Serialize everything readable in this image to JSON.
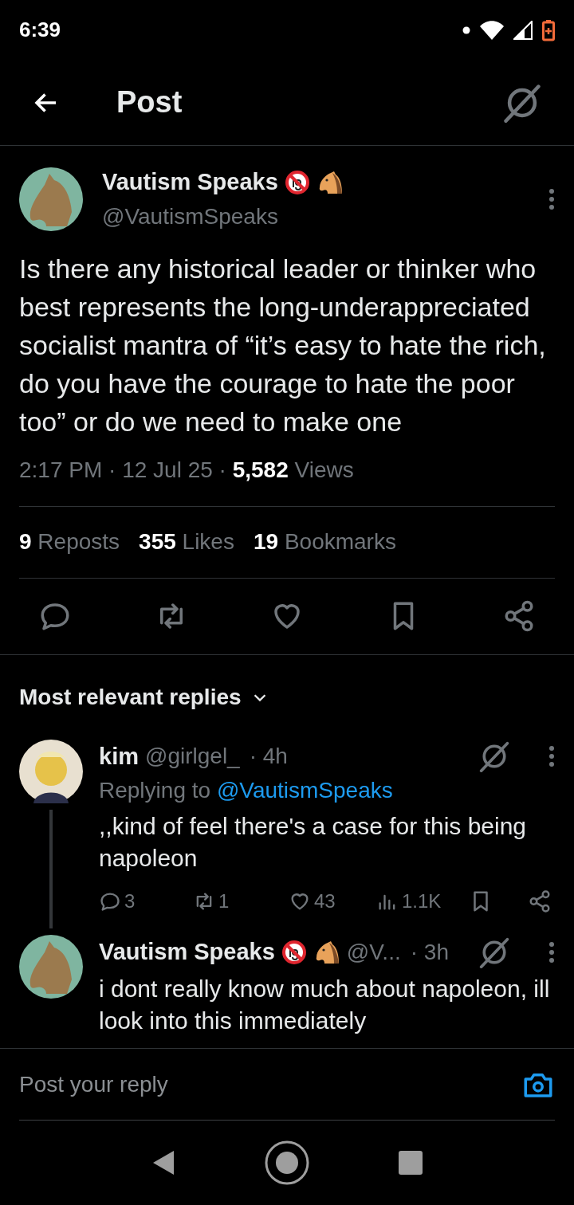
{
  "status_bar": {
    "time": "6:39"
  },
  "header": {
    "title": "Post"
  },
  "post": {
    "author": {
      "name": "Vautism Speaks",
      "handle": "@VautismSpeaks",
      "emoji_badges": true
    },
    "text": "Is there any historical leader or thinker who best represents the long-underappreciated socialist mantra of “it’s easy to hate the rich, do you have the courage to hate the poor too” or do we need to make one",
    "meta": "2:17 PM · 12 Jul 25 · **5,582** Views",
    "stats": [
      "**9** Reposts",
      "**355** Likes",
      "**19** Bookmarks"
    ]
  },
  "replies_sort": {
    "label": "Most relevant replies"
  },
  "replies": [
    {
      "author": {
        "name": "kim",
        "handle": "@girlgel_",
        "emoji_badges": false
      },
      "time": "· 4h",
      "replying_to": {
        "label": "Replying to",
        "handle": "@VautismSpeaks"
      },
      "text": ",,kind of feel there's a case for this being napoleon",
      "thread_line": true,
      "counts": {
        "replies": "3",
        "reposts": "1",
        "likes": "43",
        "views": "1.1K"
      }
    },
    {
      "author": {
        "name": "Vautism Speaks",
        "handle": "@V...",
        "emoji_badges": true
      },
      "time": "· 3h",
      "text": "i dont really know much about napoleon, ill look into this immediately",
      "thread_line": false
    }
  ],
  "reply_bar": {
    "placeholder": "Post your reply"
  }
}
